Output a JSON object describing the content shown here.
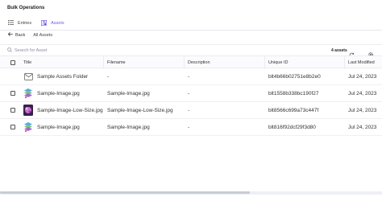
{
  "app": {
    "title": "Bulk Operations"
  },
  "tabs": [
    {
      "label": "Entries",
      "icon": "entries-icon",
      "active": false
    },
    {
      "label": "Assets",
      "icon": "assets-icon",
      "active": true
    }
  ],
  "nav": {
    "back_label": "Back",
    "breadcrumb": "All Assets"
  },
  "toolbar": {
    "search_placeholder": "Search for Asset",
    "count_label": "4 assets"
  },
  "table": {
    "headers": {
      "title": "Title",
      "filename": "Filename",
      "description": "Description",
      "uid": "Unique ID",
      "modified": "Last Modified"
    },
    "rows": [
      {
        "title": "Sample Assets Folder",
        "filename": "-",
        "description": "-",
        "uid": "blt4b66b02751e8b2e0",
        "modified": "Jul 24, 2023",
        "type": "folder"
      },
      {
        "title": "Sample-Image.jpg",
        "filename": "Sample-Image.jpg",
        "description": "-",
        "uid": "blt1558b338bc190f27",
        "modified": "Jul 24, 2023",
        "type": "image-green"
      },
      {
        "title": "Sample-Image-Low-Size.jpg",
        "filename": "Sample-Image-Low-Size.jpg",
        "description": "-",
        "uid": "blt8566c699a73c447f",
        "modified": "Jul 24, 2023",
        "type": "image-purple"
      },
      {
        "title": "Sample-Image.jpg",
        "filename": "Sample-Image.jpg",
        "description": "-",
        "uid": "blt816f92dcf29f3d80",
        "modified": "Jul 24, 2023",
        "type": "image-green"
      }
    ]
  },
  "colors": {
    "accent": "#6c5ce7"
  }
}
